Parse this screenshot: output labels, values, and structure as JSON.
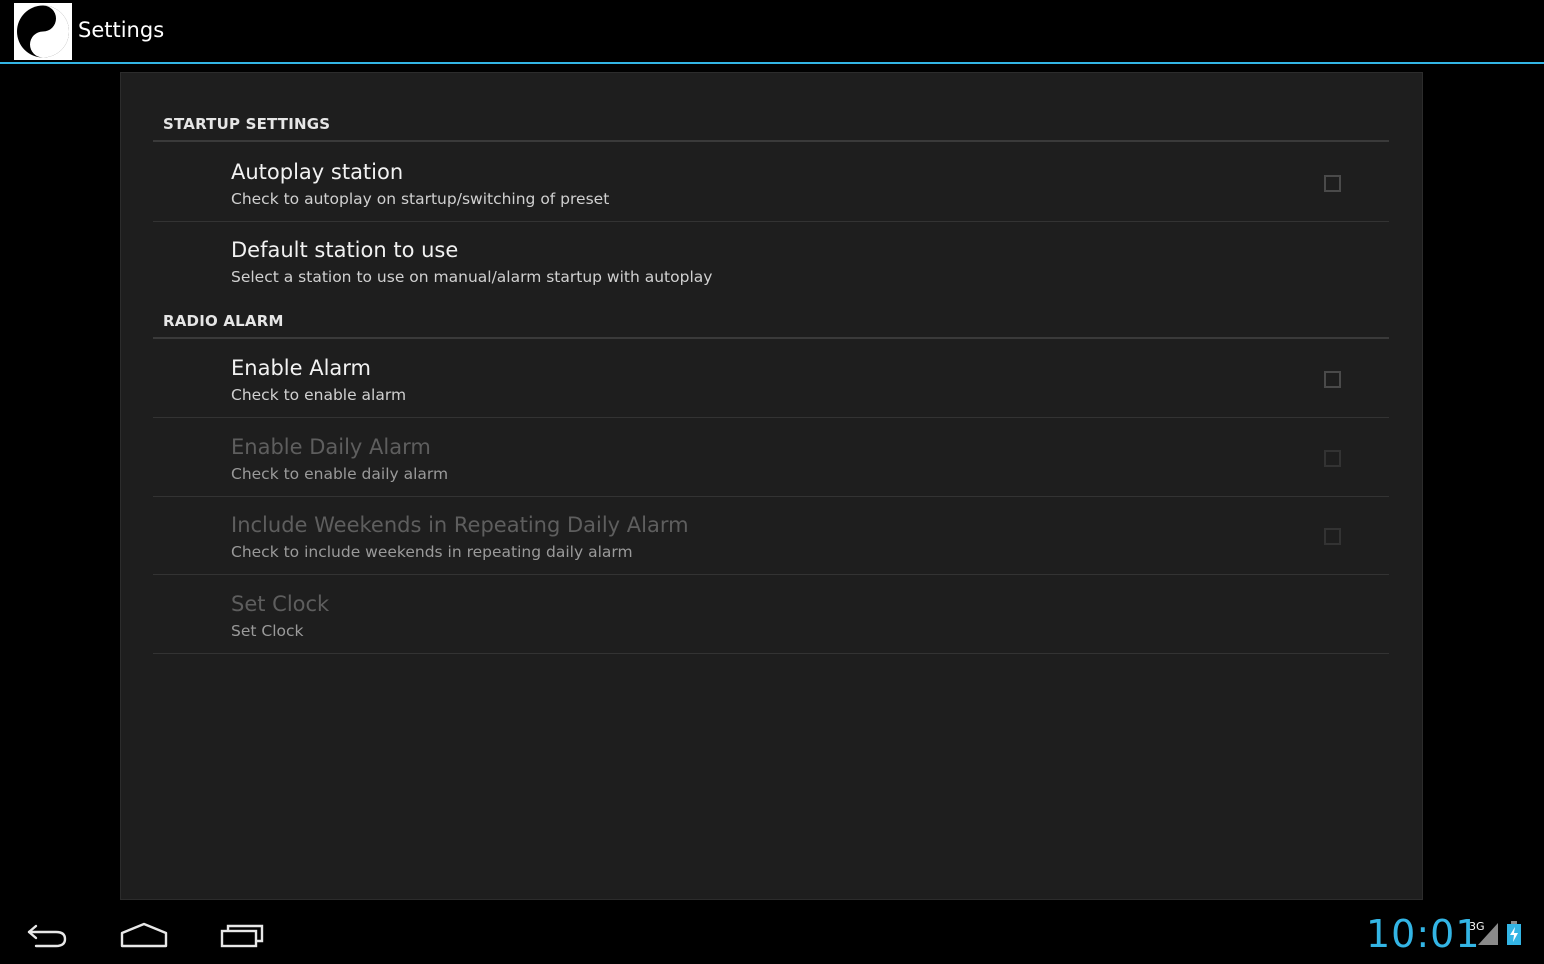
{
  "app": {
    "title": "Settings",
    "icon": "yin-yang-icon"
  },
  "colors": {
    "accent": "#33b5e5",
    "background": "#000000",
    "panel": "#1e1e1e"
  },
  "categories": [
    {
      "label": "STARTUP SETTINGS",
      "items": [
        {
          "title": "Autoplay station",
          "summary": "Check to autoplay on startup/switching of preset",
          "checkbox": true,
          "checked": false,
          "enabled": true
        },
        {
          "title": "Default station to use",
          "summary": "Select a station to use on manual/alarm startup with autoplay",
          "checkbox": false,
          "enabled": true
        }
      ]
    },
    {
      "label": "RADIO ALARM",
      "items": [
        {
          "title": "Enable Alarm",
          "summary": "Check to enable alarm",
          "checkbox": true,
          "checked": false,
          "enabled": true
        },
        {
          "title": "Enable Daily Alarm",
          "summary": "Check to enable daily alarm",
          "checkbox": true,
          "checked": false,
          "enabled": false
        },
        {
          "title": "Include Weekends in Repeating Daily Alarm",
          "summary": "Check to include weekends in repeating daily alarm",
          "checkbox": true,
          "checked": false,
          "enabled": false
        },
        {
          "title": "Set Clock",
          "summary": "Set Clock",
          "checkbox": false,
          "enabled": false
        }
      ]
    }
  ],
  "navbar": {
    "back_icon": "back-icon",
    "home_icon": "home-icon",
    "recents_icon": "recent-apps-icon"
  },
  "status": {
    "time": "10:01",
    "network": "3G",
    "signal_icon": "signal-icon",
    "battery_icon": "battery-charging-icon"
  }
}
